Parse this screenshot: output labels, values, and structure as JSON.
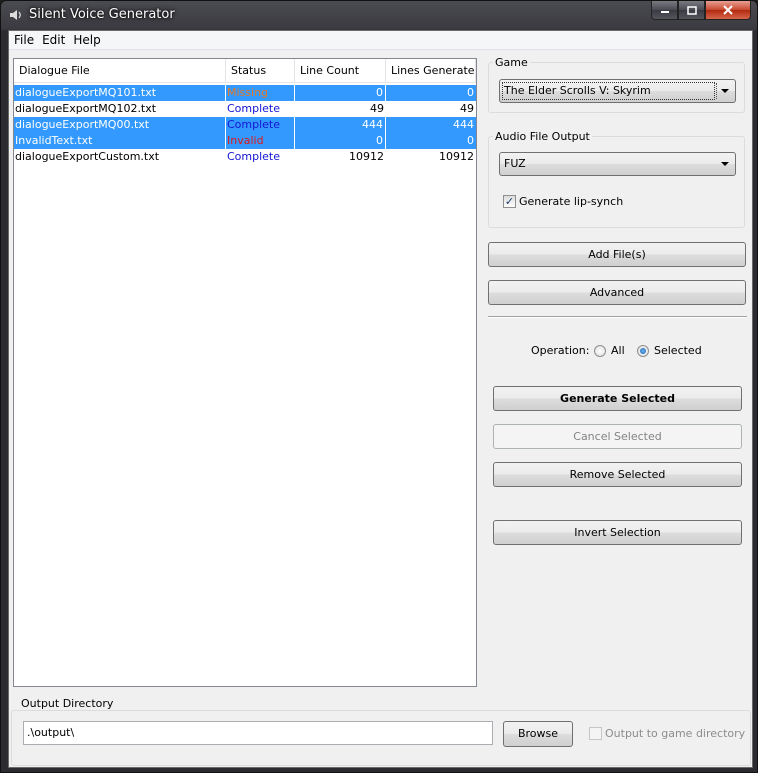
{
  "window": {
    "title": "Silent Voice Generator"
  },
  "menu": [
    "File",
    "Edit",
    "Help"
  ],
  "list": {
    "columns": [
      "Dialogue File",
      "Status",
      "Line Count",
      "Lines Generated"
    ],
    "rows": [
      {
        "file": "dialogueExportMQ101.txt",
        "status": "Missing",
        "status_color": "#e07a2c",
        "line_count": "0",
        "lines_generated": "0",
        "selected": true
      },
      {
        "file": "dialogueExportMQ102.txt",
        "status": "Complete",
        "status_color": "#1515d4",
        "line_count": "49",
        "lines_generated": "49",
        "selected": false
      },
      {
        "file": "dialogueExportMQ00.txt",
        "status": "Complete",
        "status_color": "#1515d4",
        "line_count": "444",
        "lines_generated": "444",
        "selected": true
      },
      {
        "file": "InvalidText.txt",
        "status": "Invalid",
        "status_color": "#e01818",
        "line_count": "0",
        "lines_generated": "0",
        "selected": true
      },
      {
        "file": "dialogueExportCustom.txt",
        "status": "Complete",
        "status_color": "#1515d4",
        "line_count": "10912",
        "lines_generated": "10912",
        "selected": false
      }
    ]
  },
  "game": {
    "label": "Game",
    "selected": "The Elder Scrolls V: Skyrim"
  },
  "audio": {
    "label": "Audio File Output",
    "selected": "FUZ",
    "lip_synch_label": "Generate lip-synch",
    "lip_synch_checked": true
  },
  "buttons": {
    "add_files": "Add File(s)",
    "advanced": "Advanced",
    "generate_selected": "Generate Selected",
    "cancel_selected": "Cancel Selected",
    "remove_selected": "Remove Selected",
    "invert_selection": "Invert Selection",
    "browse": "Browse"
  },
  "operation": {
    "label": "Operation:",
    "options": [
      "All",
      "Selected"
    ],
    "selected": "Selected"
  },
  "output": {
    "label": "Output Directory",
    "path": ".\\output\\",
    "game_dir_label": "Output to game directory",
    "game_dir_checked": false
  },
  "colors": {
    "selection": "#3399ff"
  }
}
